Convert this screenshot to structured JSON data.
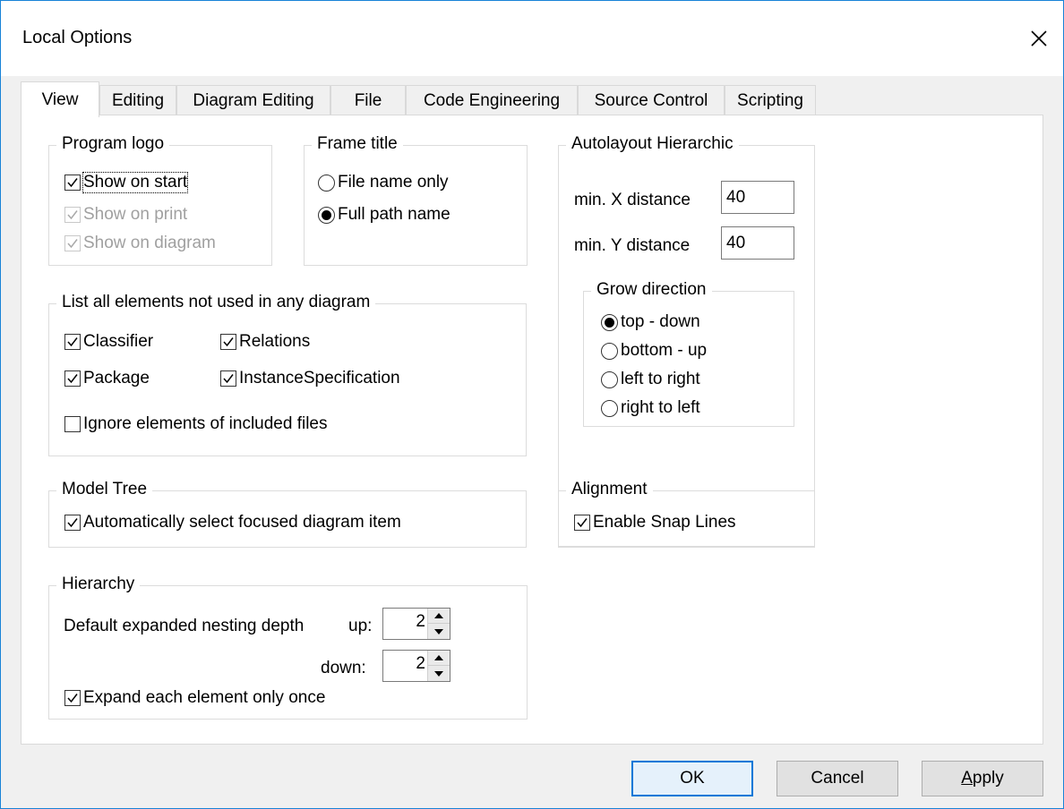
{
  "window": {
    "title": "Local Options"
  },
  "tabs": [
    "View",
    "Editing",
    "Diagram Editing",
    "File",
    "Code Engineering",
    "Source Control",
    "Scripting"
  ],
  "program_logo": {
    "legend": "Program logo",
    "show_on_start": "Show on start",
    "show_on_print": "Show on print",
    "show_on_diagram": "Show on diagram"
  },
  "frame_title": {
    "legend": "Frame title",
    "file_name_only": "File name only",
    "full_path_name": "Full path name"
  },
  "autolayout": {
    "legend": "Autolayout Hierarchic",
    "min_x_label": "min. X distance",
    "min_x_value": "40",
    "min_y_label": "min. Y distance",
    "min_y_value": "40",
    "grow": {
      "legend": "Grow direction",
      "top_down": "top - down",
      "bottom_up": "bottom - up",
      "left_to_right": "left to right",
      "right_to_left": "right to left"
    }
  },
  "list_elements": {
    "legend": "List all elements not used in any diagram",
    "classifier": "Classifier",
    "relations": "Relations",
    "package": "Package",
    "instance_spec": "InstanceSpecification",
    "ignore_included": "Ignore elements of included files"
  },
  "model_tree": {
    "legend": "Model Tree",
    "auto_select": "Automatically select focused diagram item"
  },
  "alignment": {
    "legend": "Alignment",
    "snap_lines": "Enable Snap Lines"
  },
  "hierarchy": {
    "legend": "Hierarchy",
    "depth_label": "Default expanded nesting depth",
    "up_label": "up:",
    "up_value": "2",
    "down_label": "down:",
    "down_value": "2",
    "expand_once": "Expand each element only once"
  },
  "buttons": {
    "ok": "OK",
    "cancel": "Cancel",
    "apply_pre": "",
    "apply_ul": "A",
    "apply_post": "pply"
  }
}
